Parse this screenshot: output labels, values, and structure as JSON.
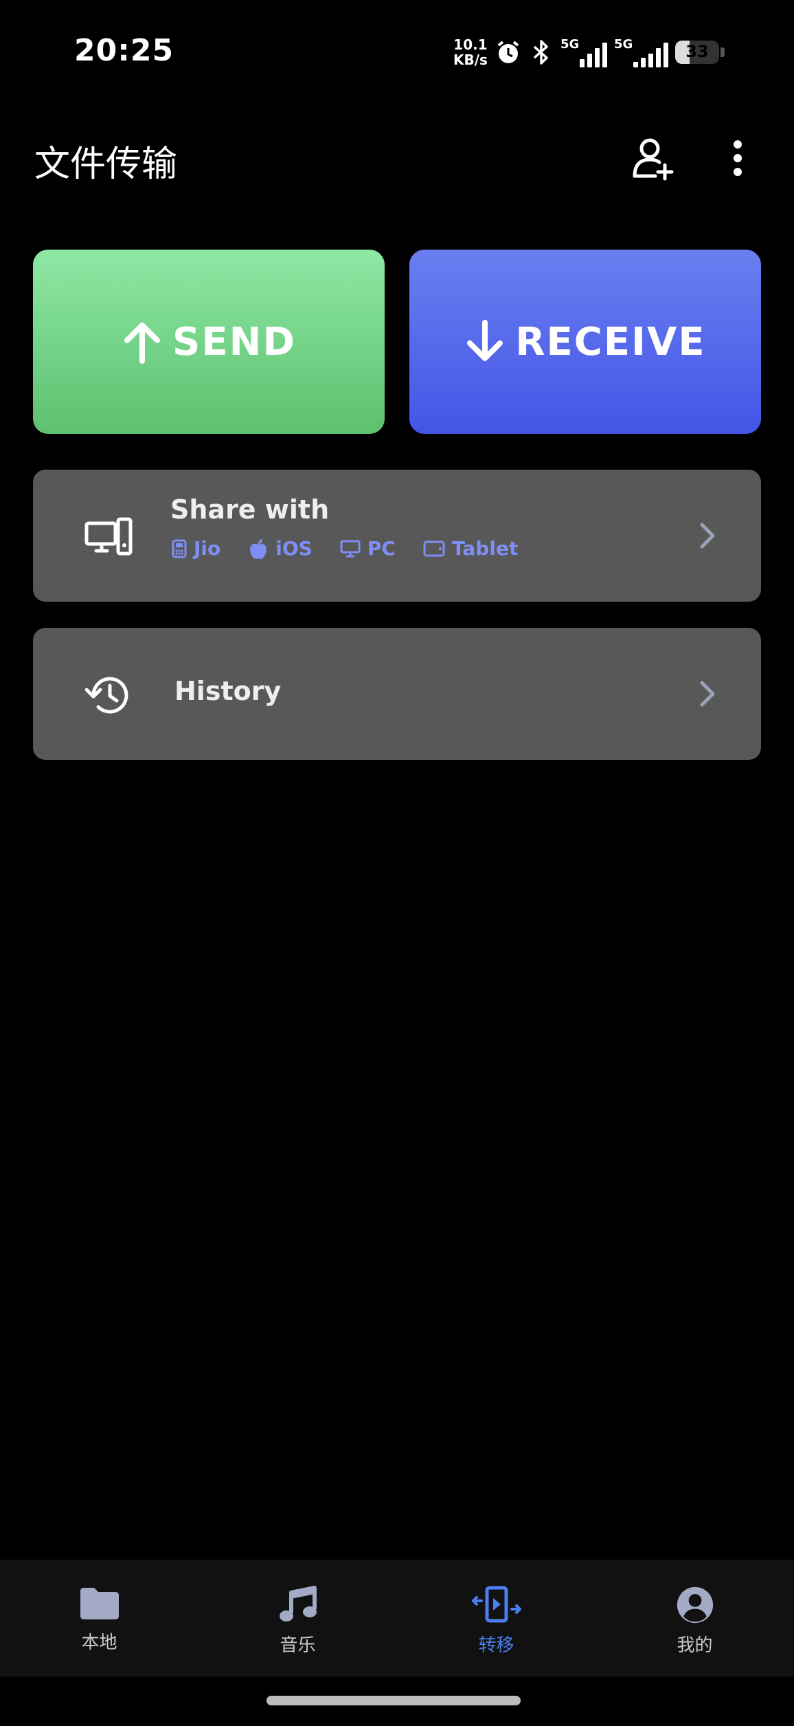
{
  "status_bar": {
    "time": "20:25",
    "net_speed_value": "10.1",
    "net_speed_unit": "KB/s",
    "signal1_label": "5G",
    "signal2_label": "5G",
    "battery_level": "33"
  },
  "app_bar": {
    "title": "文件传输"
  },
  "actions": {
    "send_label": "SEND",
    "receive_label": "RECEIVE"
  },
  "share_card": {
    "title": "Share with",
    "targets": [
      {
        "label": "Jio",
        "icon": "feature-phone-icon"
      },
      {
        "label": "iOS",
        "icon": "apple-icon"
      },
      {
        "label": "PC",
        "icon": "monitor-icon"
      },
      {
        "label": "Tablet",
        "icon": "tablet-icon"
      }
    ]
  },
  "history_card": {
    "label": "History"
  },
  "bottom_nav": {
    "items": [
      {
        "label": "本地",
        "icon": "folder-icon"
      },
      {
        "label": "音乐",
        "icon": "music-note-icon"
      },
      {
        "label": "转移",
        "icon": "transfer-icon",
        "active": true
      },
      {
        "label": "我的",
        "icon": "account-icon"
      }
    ]
  },
  "colors": {
    "send_gradient_top": "#8ee8a4",
    "send_gradient_bottom": "#5ec06f",
    "receive_gradient_top": "#6a7ff0",
    "receive_gradient_bottom": "#4455e6",
    "accent": "#4b7ef0",
    "card_bg": "#585858"
  }
}
